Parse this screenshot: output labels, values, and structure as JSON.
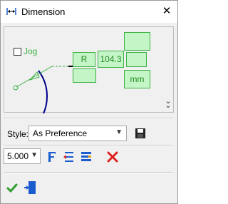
{
  "window": {
    "title": "Dimension"
  },
  "preview": {
    "jog_label": "Jog",
    "prefix_text": "R",
    "value_text": "104.3",
    "units_text": "mm"
  },
  "style": {
    "label": "Style:",
    "selected": "As Preference"
  },
  "text_size": {
    "selected": "5.000"
  },
  "colors": {
    "accent_green": "#3cb043",
    "field_fill": "#c4f5c6",
    "delete_red": "#e02020",
    "tool_blue": "#1a5ccf"
  }
}
